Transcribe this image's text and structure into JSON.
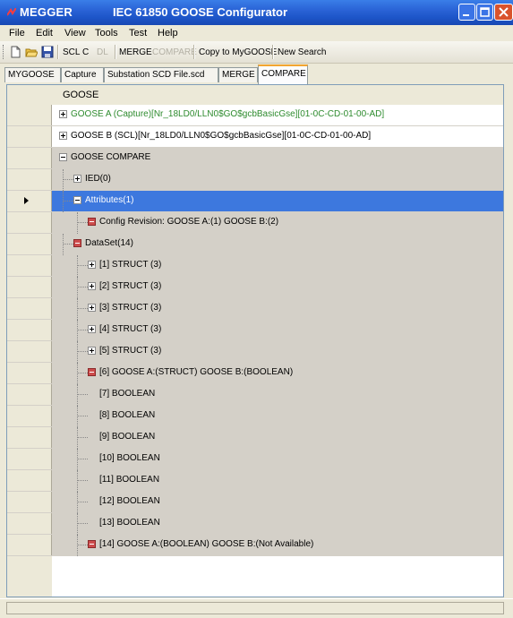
{
  "window": {
    "app_name": "MEGGER",
    "title": "IEC 61850 GOOSE Configurator"
  },
  "menu": [
    "File",
    "Edit",
    "View",
    "Tools",
    "Test",
    "Help"
  ],
  "toolbar": {
    "scl": "SCL",
    "c": "C",
    "dl": "DL",
    "merge": "MERGE",
    "compare": "COMPARE",
    "copy": "Copy to MyGOOSE",
    "new_search": "New Search"
  },
  "tabs": [
    "MYGOOSE",
    "Capture",
    "Substation SCD File.scd",
    "MERGE",
    "COMPARE"
  ],
  "active_tab": "COMPARE",
  "grid": {
    "column_header": "GOOSE",
    "rows": [
      {
        "label": "GOOSE A (Capture)[Nr_18LD0/LLN0$GO$gcbBasicGse][01-0C-CD-01-00-AD]",
        "color": "#2e8b2e"
      },
      {
        "label": "GOOSE B (SCL)[Nr_18LD0/LLN0$GO$gcbBasicGse][01-0C-CD-01-00-AD]",
        "color": "#000000"
      },
      {
        "label": "GOOSE COMPARE"
      },
      {
        "label": "IED(0)"
      },
      {
        "label": "Attributes(1)"
      },
      {
        "label": "Config Revision: GOOSE A:(1)   GOOSE B:(2)"
      },
      {
        "label": "DataSet(14)"
      },
      {
        "label": "[1] STRUCT (3)"
      },
      {
        "label": "[2] STRUCT (3)"
      },
      {
        "label": "[3] STRUCT (3)"
      },
      {
        "label": "[4] STRUCT (3)"
      },
      {
        "label": "[5] STRUCT (3)"
      },
      {
        "label": "[6] GOOSE A:(STRUCT)   GOOSE B:(BOOLEAN)"
      },
      {
        "label": "[7] BOOLEAN"
      },
      {
        "label": "[8] BOOLEAN"
      },
      {
        "label": "[9] BOOLEAN"
      },
      {
        "label": "[10] BOOLEAN"
      },
      {
        "label": "[11] BOOLEAN"
      },
      {
        "label": "[12] BOOLEAN"
      },
      {
        "label": "[13] BOOLEAN"
      },
      {
        "label": "[14] GOOSE A:(BOOLEAN)   GOOSE B:(Not Available)"
      }
    ]
  },
  "colors": {
    "title_bar": "#2a63d6",
    "selection": "#3d78de",
    "difference_marker": "#cd4c4c",
    "active_tab_accent": "#f2a531"
  }
}
